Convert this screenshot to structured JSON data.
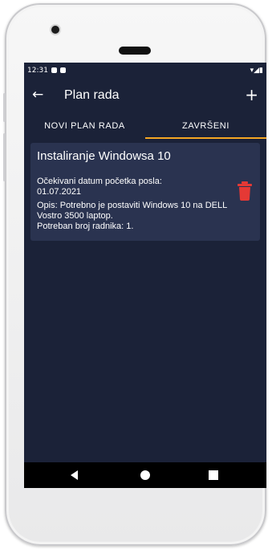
{
  "status_bar": {
    "time": "12:31"
  },
  "app_bar": {
    "back_icon": "arrow-left-icon",
    "title": "Plan rada",
    "add_label": "+"
  },
  "tabs": [
    {
      "label": "NOVI PLAN RADA",
      "selected": false
    },
    {
      "label": "ZAVRŠENI",
      "selected": true
    }
  ],
  "colors": {
    "background": "#1b2238",
    "card": "#2a3350",
    "tab_indicator": "#f5a623",
    "delete": "#e53935"
  },
  "cards": [
    {
      "title": "Instaliranje Windowsa 10",
      "date_label": "Očekivani datum početka posla:",
      "date_value": "01.07.2021",
      "description": "Opis: Potrebno je postaviti Windows 10 na DELL Vostro 3500 laptop.",
      "workers": "Potreban broj radnika: 1.",
      "delete_icon": "trash-icon"
    }
  ],
  "nav_bar": {
    "back": "back-triangle-icon",
    "home": "home-circle-icon",
    "recents": "recents-square-icon"
  }
}
